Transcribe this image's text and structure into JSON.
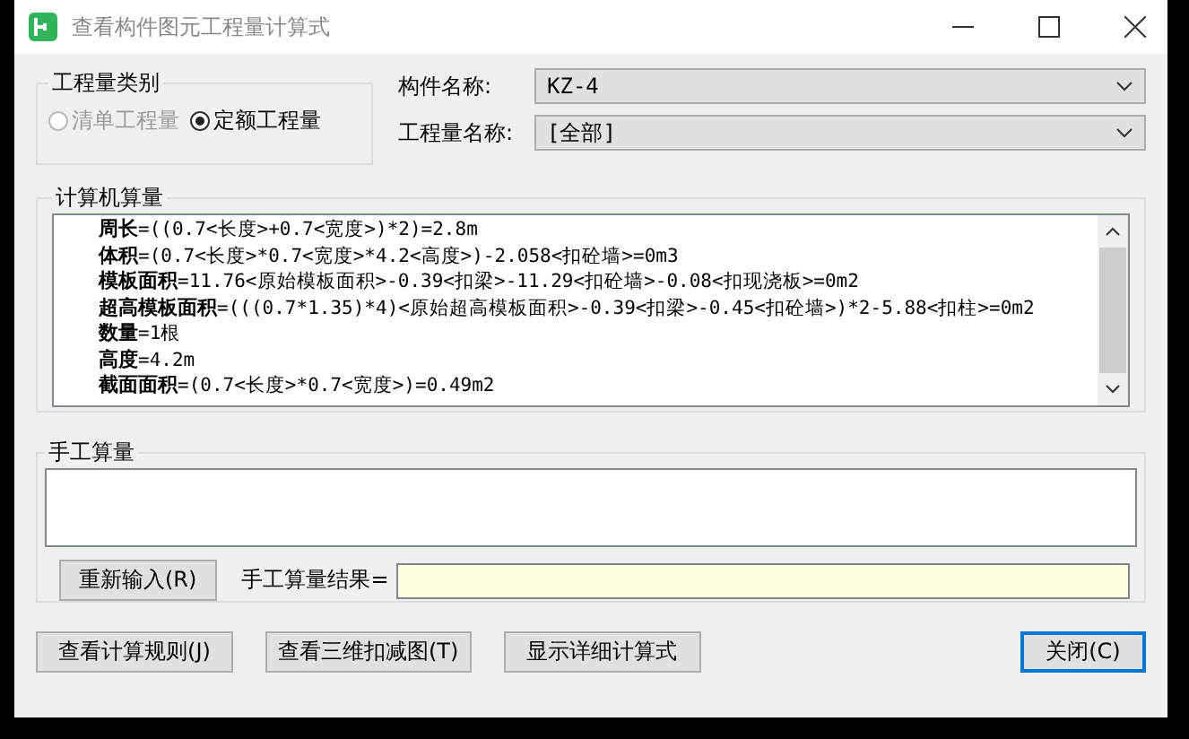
{
  "window": {
    "title": "查看构件图元工程量计算式"
  },
  "quantity_type": {
    "legend": "工程量类别",
    "options": [
      {
        "label": "清单工程量",
        "selected": false,
        "disabled": true
      },
      {
        "label": "定额工程量",
        "selected": true,
        "disabled": false
      }
    ]
  },
  "fields": [
    {
      "label": "构件名称:",
      "value": "KZ-4"
    },
    {
      "label": "工程量名称:",
      "value": "[全部]"
    }
  ],
  "computed": {
    "legend": "计算机算量",
    "lines": [
      {
        "label": "周长",
        "formula": "=((0.7<长度>+0.7<宽度>)*2)=2.8m"
      },
      {
        "label": "体积",
        "formula": "=(0.7<长度>*0.7<宽度>*4.2<高度>)-2.058<扣砼墙>=0m3"
      },
      {
        "label": "模板面积",
        "formula": "=11.76<原始模板面积>-0.39<扣梁>-11.29<扣砼墙>-0.08<扣现浇板>=0m2"
      },
      {
        "label": "超高模板面积",
        "formula": "=(((0.7*1.35)*4)<原始超高模板面积>-0.39<扣梁>-0.45<扣砼墙>)*2-5.88<扣柱>=0m2"
      },
      {
        "label": "数量",
        "formula": "=1根"
      },
      {
        "label": "高度",
        "formula": "=4.2m"
      },
      {
        "label": "截面面积",
        "formula": "=(0.7<长度>*0.7<宽度>)=0.49m2"
      }
    ]
  },
  "manual": {
    "legend": "手工算量",
    "reset_button": "重新输入(R)",
    "result_label": "手工算量结果="
  },
  "buttons": [
    {
      "label": "查看计算规则(J)",
      "default": false
    },
    {
      "label": "查看三维扣减图(T)",
      "default": false
    },
    {
      "label": "显示详细计算式",
      "default": false
    },
    {
      "label": "关闭(C)",
      "default": true
    }
  ]
}
